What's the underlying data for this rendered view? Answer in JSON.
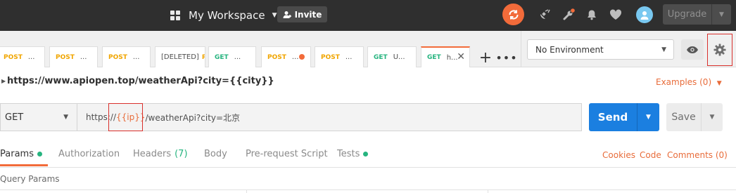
{
  "topbar": {
    "workspace_label": "My Workspace",
    "invite_label": "Invite",
    "upgrade_label": "Upgrade",
    "icons": [
      "workspace-grid-icon",
      "invite-user-icon",
      "sync-icon",
      "satellite-icon",
      "wrench-icon",
      "bell-icon",
      "heart-icon",
      "avatar"
    ],
    "sync_color": "#f26b3a"
  },
  "tabs": [
    {
      "method": "POST",
      "name": "..."
    },
    {
      "method": "POST",
      "name": "..."
    },
    {
      "method": "POST",
      "name": "..."
    },
    {
      "method": "[DELETED]",
      "name": "P"
    },
    {
      "method": "GET",
      "name": "..."
    },
    {
      "method": "POST",
      "name": "..."
    },
    {
      "method": "POST",
      "name": "..."
    },
    {
      "method": "GET",
      "name": "U..."
    },
    {
      "method": "GET",
      "name": "h..."
    }
  ],
  "tab_actions": {
    "add": "+",
    "more": "•••"
  },
  "environment": {
    "selected": "No Environment"
  },
  "request": {
    "title": "https://www.apiopen.top/weatherApi?city={{city}}",
    "examples_label": "Examples (0)",
    "method": "GET",
    "url_prefix": "https://",
    "url_var": "{{ip}}",
    "url_suffix": "/weatherApi?city=北京",
    "send_label": "Send",
    "save_label": "Save"
  },
  "subtabs": {
    "params": "Params",
    "authorization": "Authorization",
    "headers": "Headers",
    "headers_count": "(7)",
    "body": "Body",
    "prerequest": "Pre-request Script",
    "tests": "Tests",
    "cookies": "Cookies",
    "code": "Code",
    "comments": "Comments (0)"
  },
  "query_params_label": "Query Params",
  "colors": {
    "accent": "#f26b3a",
    "send_blue": "#1b7fe0",
    "get_green": "#26b47f",
    "post_yellow": "#f0a500",
    "highlight_red": "#d9302c"
  }
}
